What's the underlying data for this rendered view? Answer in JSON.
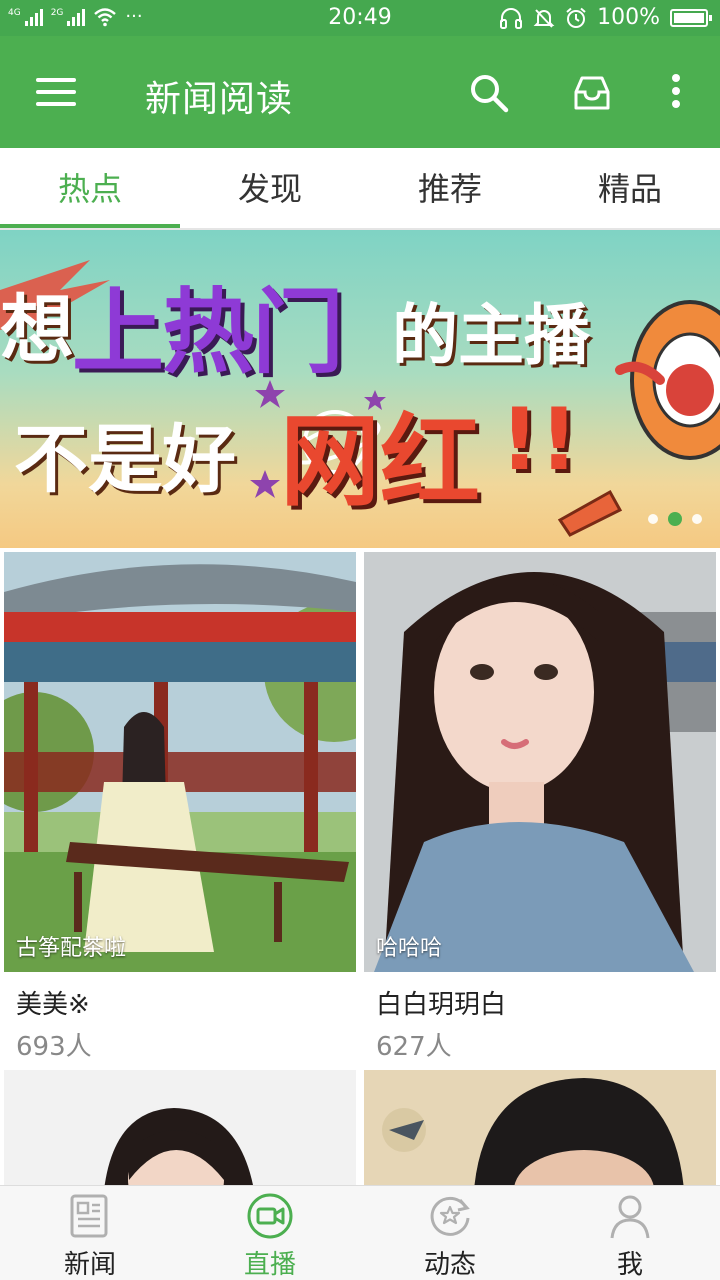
{
  "status_bar": {
    "network_1": "4G",
    "network_2": "2G",
    "more": "···",
    "time": "20:49",
    "battery": "100%"
  },
  "app_bar": {
    "title": "新闻阅读"
  },
  "tabs": [
    {
      "label": "热点",
      "active": true
    },
    {
      "label": "发现",
      "active": false
    },
    {
      "label": "推荐",
      "active": false
    },
    {
      "label": "精品",
      "active": false
    }
  ],
  "banner": {
    "line1_a": "想",
    "line1_b": "上热门",
    "line1_c": "的主播",
    "line2_a": "不是好",
    "line2_b": "网红",
    "line2_c": "!!",
    "dots": 3,
    "active_dot": 2
  },
  "cards": [
    {
      "caption": "古筝配茶啦",
      "name": "美美※",
      "count": "693人"
    },
    {
      "caption": "哈哈哈",
      "name": "白白玥玥白",
      "count": "627人"
    },
    {
      "caption": "",
      "name": "",
      "count": ""
    },
    {
      "caption": "",
      "name": "",
      "count": ""
    }
  ],
  "bottom_nav": [
    {
      "label": "新闻",
      "icon": "newspaper-icon",
      "active": false
    },
    {
      "label": "直播",
      "icon": "video-camera-icon",
      "active": true
    },
    {
      "label": "动态",
      "icon": "star-refresh-icon",
      "active": false
    },
    {
      "label": "我",
      "icon": "person-icon",
      "active": false
    }
  ],
  "colors": {
    "primary": "#4caf50",
    "status_bar": "#45a84f"
  }
}
